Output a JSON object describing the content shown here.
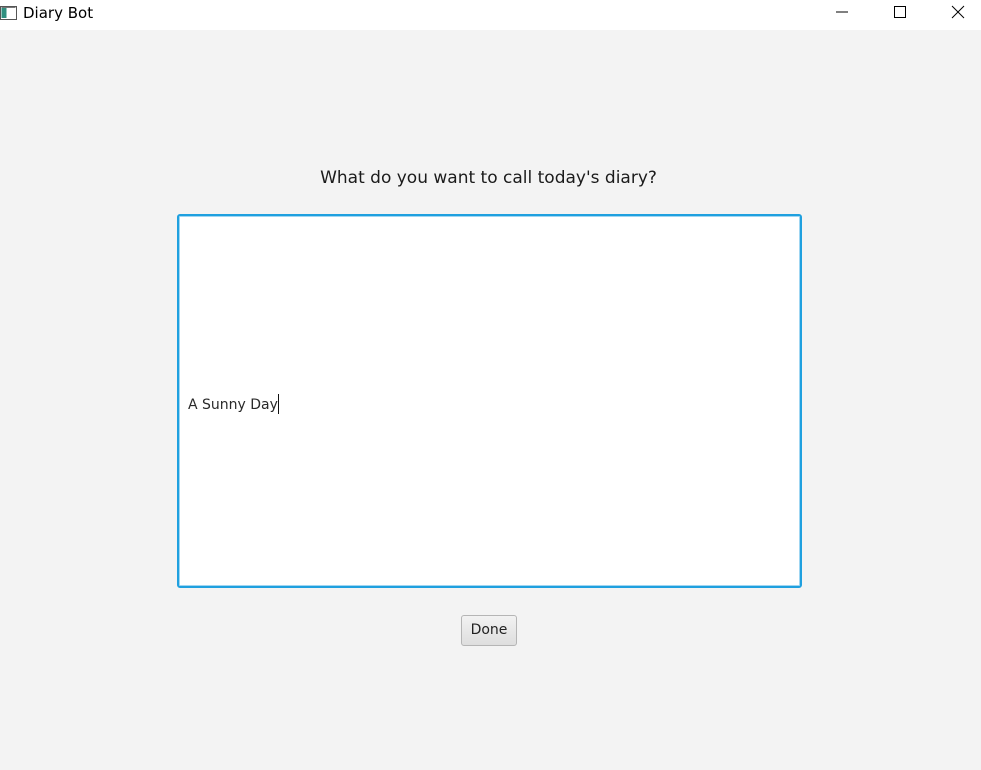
{
  "window": {
    "title": "Diary Bot",
    "app_icon": "window-app-icon",
    "controls": {
      "minimize_icon": "minimize-icon",
      "maximize_icon": "maximize-icon",
      "close_icon": "close-icon"
    }
  },
  "form": {
    "prompt": "What do you want to call today's diary?",
    "title_value": "A Sunny Day",
    "done_label": "Done"
  },
  "colors": {
    "background": "#f3f3f3",
    "focus_border": "#1fa0df",
    "titlebar": "#ffffff"
  }
}
